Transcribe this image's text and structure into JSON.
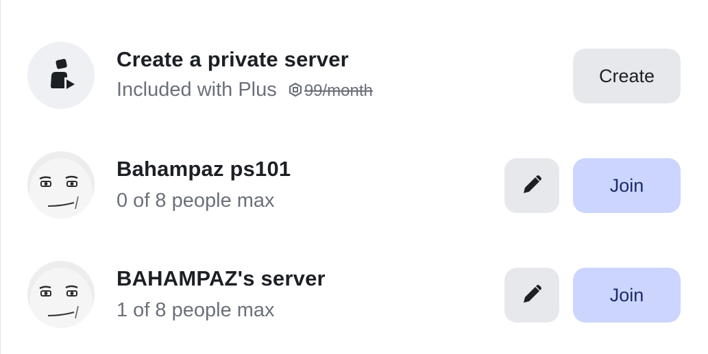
{
  "create_server": {
    "title": "Create a private server",
    "subtitle": "Included with Plus",
    "price": "99/month",
    "button_label": "Create",
    "icon": "private-server-icon"
  },
  "servers": [
    {
      "name": "Bahampaz ps101",
      "capacity": "0 of 8 people max",
      "join_label": "Join",
      "edit_icon": "pencil-icon",
      "avatar_icon": "man-face-avatar"
    },
    {
      "name": "BAHAMPAZ's server",
      "capacity": "1 of 8 people max",
      "join_label": "Join",
      "edit_icon": "pencil-icon",
      "avatar_icon": "man-face-avatar"
    }
  ],
  "colors": {
    "create_button_bg": "#e7e8ec",
    "join_button_bg": "#cbd5fd",
    "join_text": "#1c2a6a",
    "subtitle_text": "#6a6f79"
  }
}
